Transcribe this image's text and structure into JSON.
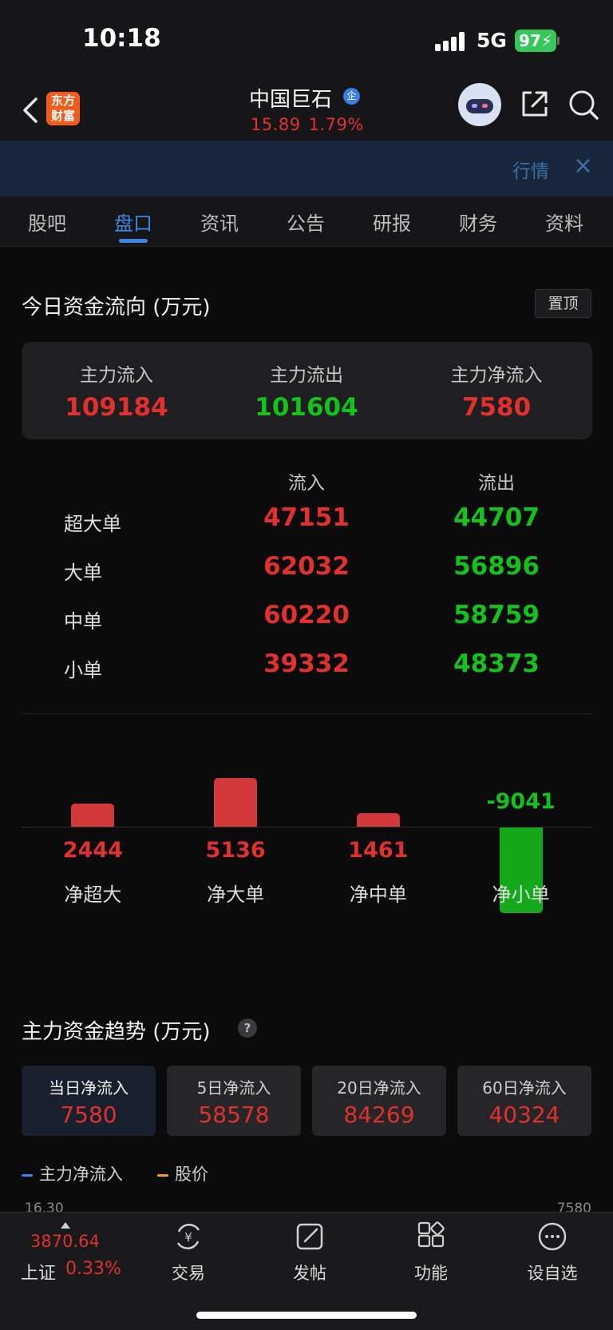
{
  "status_bar": {
    "time": "10:18",
    "network": "5G",
    "battery": "97"
  },
  "header": {
    "logo_line1": "东方",
    "logo_line2": "财富",
    "stock_name": "中国巨石",
    "badge": "企",
    "price": "15.89",
    "change_pct": "1.79%"
  },
  "banner": {
    "label": "行情",
    "close": "×"
  },
  "tabs": [
    {
      "label": "股吧"
    },
    {
      "label": "盘口",
      "active": true
    },
    {
      "label": "资讯"
    },
    {
      "label": "公告"
    },
    {
      "label": "研报"
    },
    {
      "label": "财务"
    },
    {
      "label": "资料"
    }
  ],
  "capital_flow": {
    "title": "今日资金流向 (万元)",
    "pin_label": "置顶",
    "summary": [
      {
        "label": "主力流入",
        "value": "109184",
        "color": "red"
      },
      {
        "label": "主力流出",
        "value": "101604",
        "color": "green"
      },
      {
        "label": "主力净流入",
        "value": "7580",
        "color": "red"
      }
    ],
    "columns": {
      "inflow": "流入",
      "outflow": "流出"
    },
    "rows": [
      {
        "name": "超大单",
        "inflow": "47151",
        "outflow": "44707"
      },
      {
        "name": "大单",
        "inflow": "62032",
        "outflow": "56896"
      },
      {
        "name": "中单",
        "inflow": "60220",
        "outflow": "58759"
      },
      {
        "name": "小单",
        "inflow": "39332",
        "outflow": "48373"
      }
    ]
  },
  "chart_data": {
    "type": "bar",
    "categories": [
      "净超大",
      "净大单",
      "净中单",
      "净小单"
    ],
    "values": [
      2444,
      5136,
      1461,
      -9041
    ],
    "labels": [
      "2444",
      "5136",
      "1461",
      "-9041"
    ],
    "colors": {
      "positive": "#d23a3a",
      "negative": "#14a81a"
    }
  },
  "trend": {
    "title": "主力资金趋势 (万元)",
    "help": "?",
    "periods": [
      {
        "label": "当日净流入",
        "value": "7580",
        "active": true
      },
      {
        "label": "5日净流入",
        "value": "58578"
      },
      {
        "label": "20日净流入",
        "value": "84269"
      },
      {
        "label": "60日净流入",
        "value": "40324"
      }
    ],
    "legend": [
      {
        "label": "主力净流入",
        "color": "#3b86e6"
      },
      {
        "label": "股价",
        "color": "#f0a030"
      }
    ],
    "axis_left_top": "16.30",
    "axis_right_top": "7580"
  },
  "bottom_bar": {
    "index_value": "3870.64",
    "index_name": "上证",
    "index_change": "0.33%",
    "items": [
      {
        "label": "交易",
        "icon": "trade-icon"
      },
      {
        "label": "发帖",
        "icon": "post-icon"
      },
      {
        "label": "功能",
        "icon": "functions-icon"
      },
      {
        "label": "设自选",
        "icon": "add-watchlist-icon"
      }
    ]
  }
}
